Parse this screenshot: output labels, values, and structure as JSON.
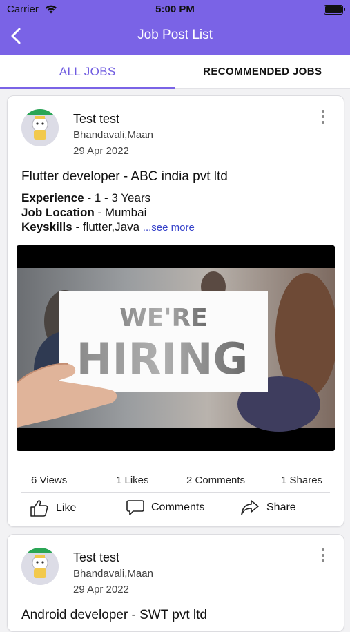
{
  "status_bar": {
    "carrier": "Carrier",
    "time": "5:00 PM"
  },
  "header": {
    "title": "Job Post List"
  },
  "tabs": [
    {
      "label": "ALL JOBS",
      "active": true
    },
    {
      "label": "RECOMMENDED JOBS",
      "active": false
    }
  ],
  "posts": [
    {
      "author": "Test test",
      "location": "Bhandavali,Maan",
      "date": "29 Apr 2022",
      "title": "Flutter developer - ABC india pvt ltd",
      "experience_label": "Experience",
      "experience_value": " - 1 - 3 Years",
      "location_label": "Job Location",
      "location_value": " - Mumbai",
      "keyskills_label": "Keyskills",
      "keyskills_value": " - flutter,Java ",
      "see_more": "...see more",
      "image_text_1": "WE'RE",
      "image_text_2": "HIRING",
      "views": "6 Views",
      "likes": "1  Likes",
      "comments": "2 Comments",
      "shares": "1 Shares",
      "like_label": "Like",
      "comments_label": "Comments",
      "share_label": "Share"
    },
    {
      "author": "Test test",
      "location": "Bhandavali,Maan",
      "date": "29 Apr 2022",
      "title": "Android developer - SWT pvt ltd"
    }
  ],
  "colors": {
    "accent": "#7a63e6",
    "tab_active": "#6f5be0",
    "link": "#3642c9"
  }
}
